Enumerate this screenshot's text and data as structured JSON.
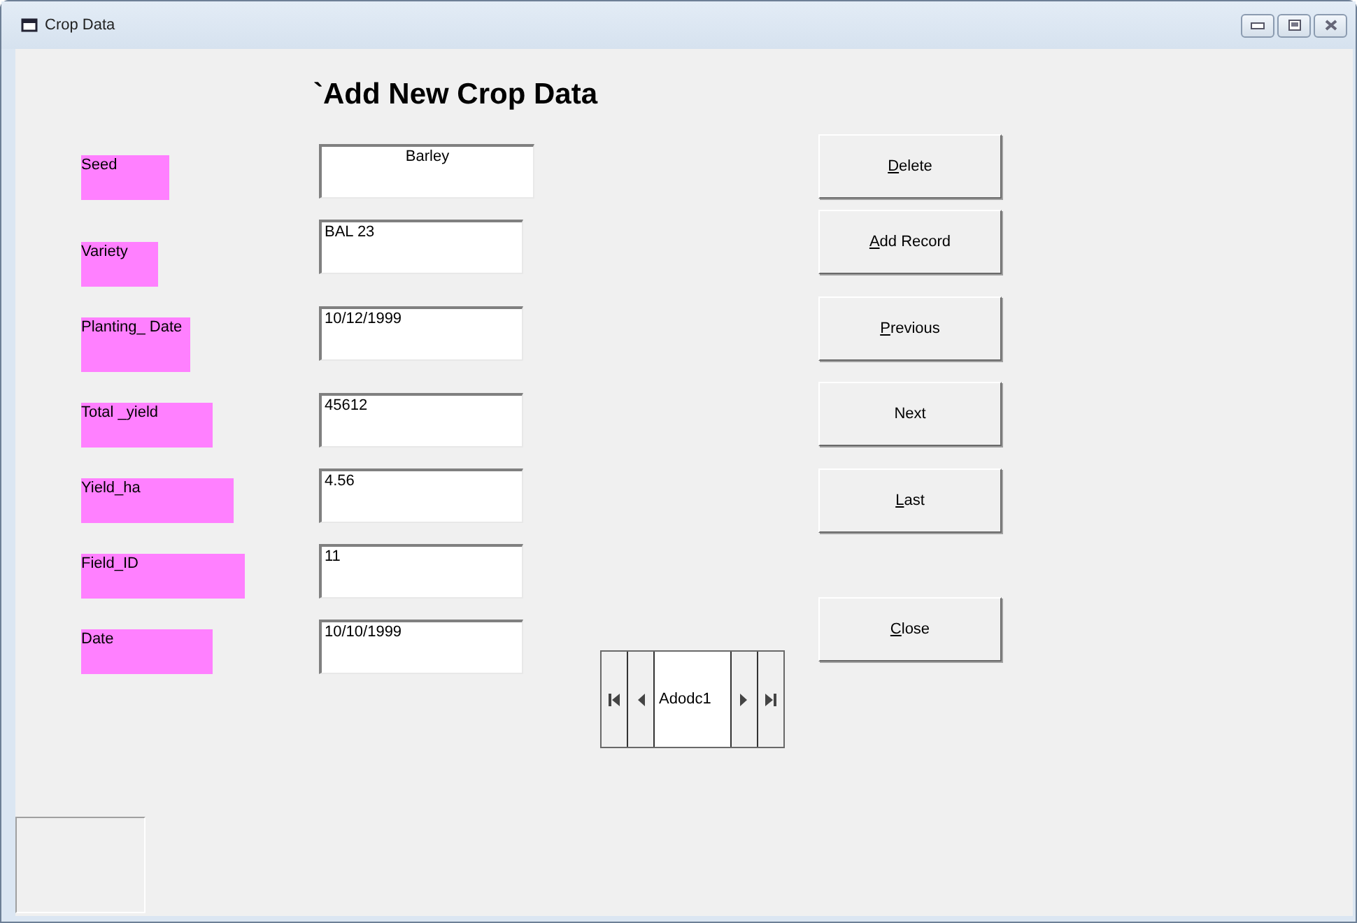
{
  "window": {
    "title": "Crop Data"
  },
  "heading": "`Add New Crop Data",
  "fields": [
    {
      "label": "Seed",
      "value": "Barley",
      "centered": true
    },
    {
      "label": "Variety",
      "value": "BAL 23",
      "centered": false
    },
    {
      "label": "Planting_ Date",
      "value": "10/12/1999",
      "centered": false
    },
    {
      "label": "Total _yield",
      "value": "45612",
      "centered": false
    },
    {
      "label": "Yield_ha",
      "value": "4.56",
      "centered": false
    },
    {
      "label": "Field_ID",
      "value": "11",
      "centered": false
    },
    {
      "label": "Date",
      "value": "10/10/1999",
      "centered": false
    }
  ],
  "buttons": [
    {
      "label": "Delete",
      "underline_first": true
    },
    {
      "label": "Add Record",
      "underline_first": true
    },
    {
      "label": "Previous",
      "underline_first": true
    },
    {
      "label": "Next",
      "underline_first": false
    },
    {
      "label": "Last",
      "underline_first": true
    },
    {
      "label": "Close",
      "underline_first": true
    }
  ],
  "data_control": {
    "caption": "Adodc1"
  }
}
